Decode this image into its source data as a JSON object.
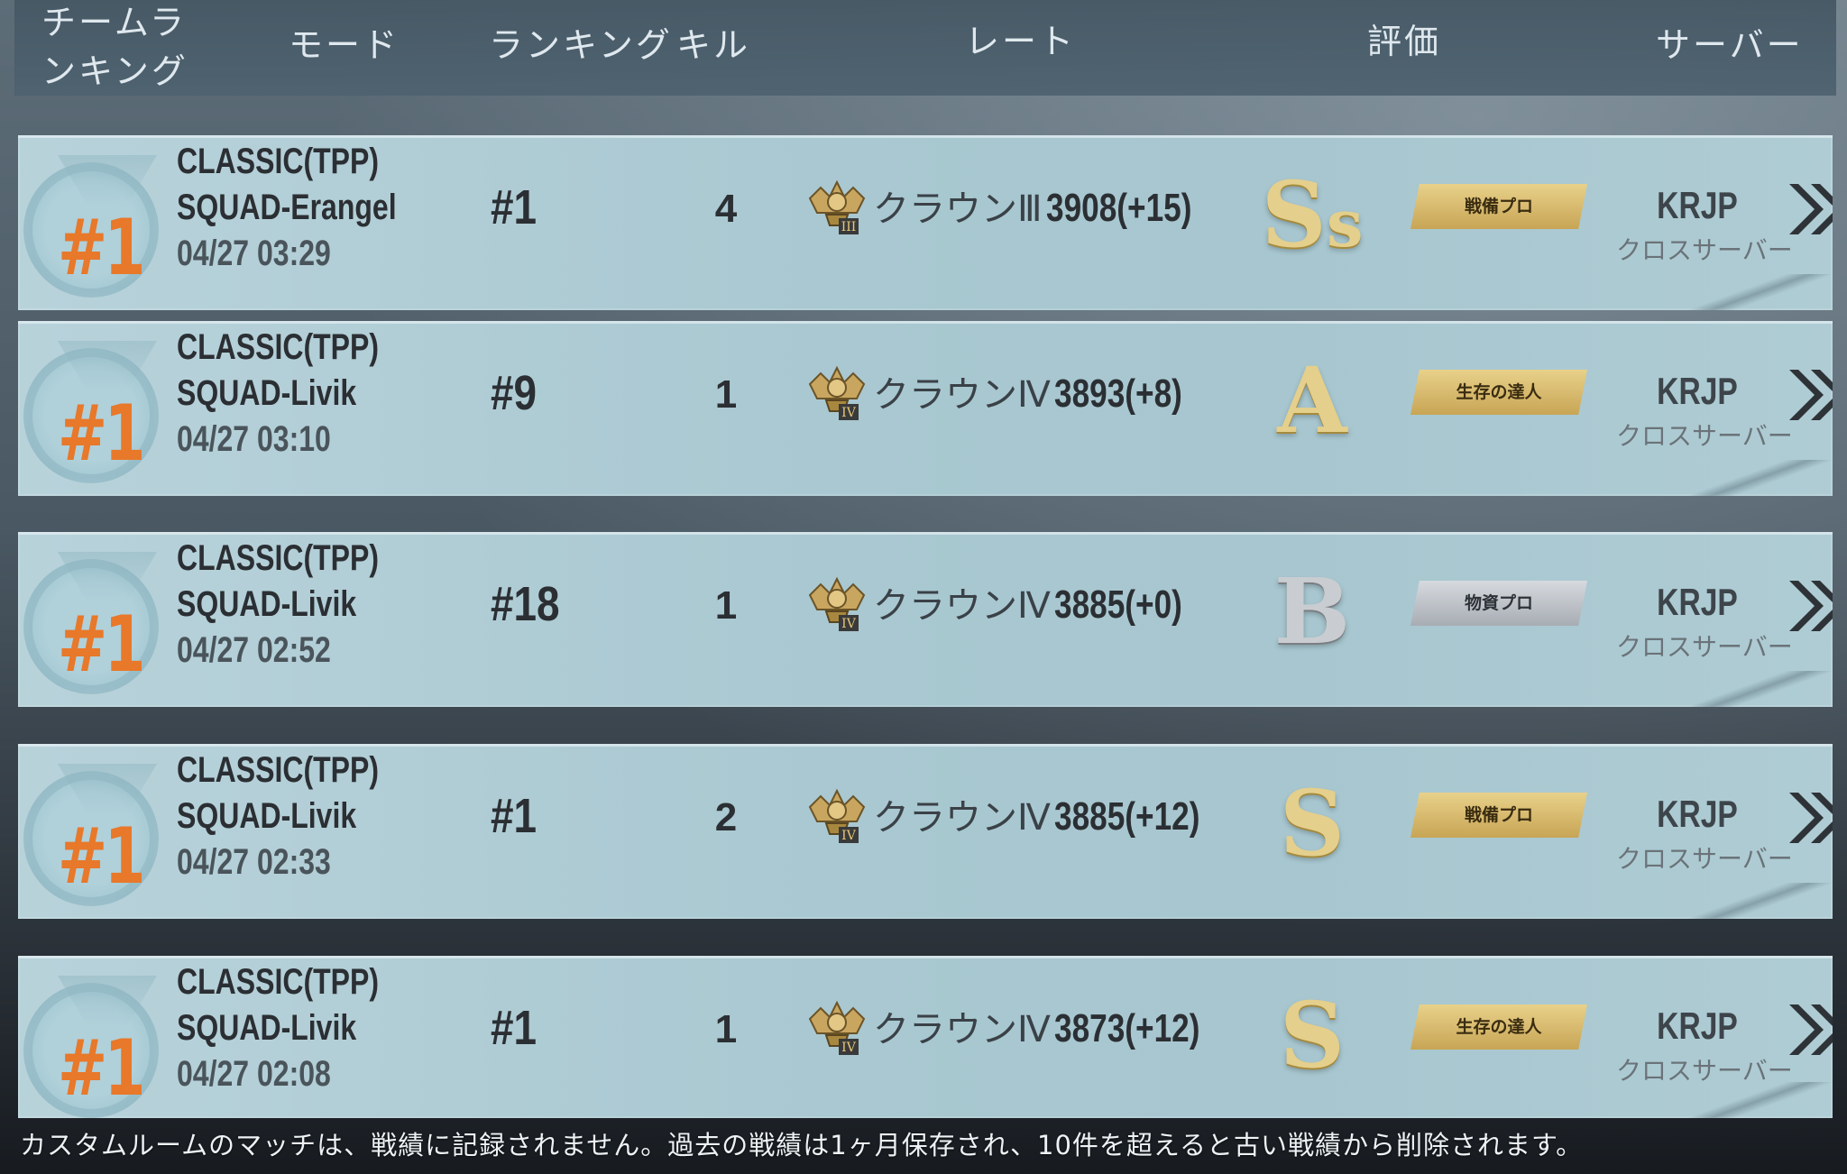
{
  "header": {
    "team_ranking": "チームランキング",
    "mode": "モード",
    "ranking": "ランキング",
    "kills": "キル",
    "rate": "レート",
    "evaluation": "評価",
    "server": "サーバー"
  },
  "rows": [
    {
      "team_rank": "#1",
      "mode_line1": "CLASSIC(TPP)",
      "mode_line2": "SQUAD-Erangel",
      "date": "04/27 03:29",
      "rank": "#1",
      "kills": "4",
      "tier": "クラウンⅢ",
      "rate": "3908(+15)",
      "grade_main": "S",
      "grade_sub": "s",
      "grade_color": "gold",
      "badge": "戦備プロ",
      "badge_color": "gold",
      "server": "KRJP",
      "server_sub": "クロスサーバー"
    },
    {
      "team_rank": "#1",
      "mode_line1": "CLASSIC(TPP)",
      "mode_line2": "SQUAD-Livik",
      "date": "04/27 03:10",
      "rank": "#9",
      "kills": "1",
      "tier": "クラウンⅣ",
      "rate": "3893(+8)",
      "grade_main": "A",
      "grade_sub": "",
      "grade_color": "gold",
      "badge": "生存の達人",
      "badge_color": "gold",
      "server": "KRJP",
      "server_sub": "クロスサーバー"
    },
    {
      "team_rank": "#1",
      "mode_line1": "CLASSIC(TPP)",
      "mode_line2": "SQUAD-Livik",
      "date": "04/27 02:52",
      "rank": "#18",
      "kills": "1",
      "tier": "クラウンⅣ",
      "rate": "3885(+0)",
      "grade_main": "B",
      "grade_sub": "",
      "grade_color": "silver",
      "badge": "物資プロ",
      "badge_color": "silver",
      "server": "KRJP",
      "server_sub": "クロスサーバー"
    },
    {
      "team_rank": "#1",
      "mode_line1": "CLASSIC(TPP)",
      "mode_line2": "SQUAD-Livik",
      "date": "04/27 02:33",
      "rank": "#1",
      "kills": "2",
      "tier": "クラウンⅣ",
      "rate": "3885(+12)",
      "grade_main": "S",
      "grade_sub": "",
      "grade_color": "gold",
      "badge": "戦備プロ",
      "badge_color": "gold",
      "server": "KRJP",
      "server_sub": "クロスサーバー"
    },
    {
      "team_rank": "#1",
      "mode_line1": "CLASSIC(TPP)",
      "mode_line2": "SQUAD-Livik",
      "date": "04/27 02:08",
      "rank": "#1",
      "kills": "1",
      "tier": "クラウンⅣ",
      "rate": "3873(+12)",
      "grade_main": "S",
      "grade_sub": "",
      "grade_color": "gold",
      "badge": "生存の達人",
      "badge_color": "gold",
      "server": "KRJP",
      "server_sub": "クロスサーバー"
    }
  ],
  "footer_note": "カスタムルームのマッチは、戦績に記録されません。過去の戦績は1ヶ月保存され、10件を超えると古い戦績から削除されます。",
  "icons": {
    "medal": "rank-medal-icon",
    "tier": "crown-tier-icon",
    "chevron": "double-chevron-right-icon"
  },
  "colors": {
    "medal_text": "#e8782a",
    "gold": "#e4cf8c",
    "silver": "#c9cdd1"
  }
}
